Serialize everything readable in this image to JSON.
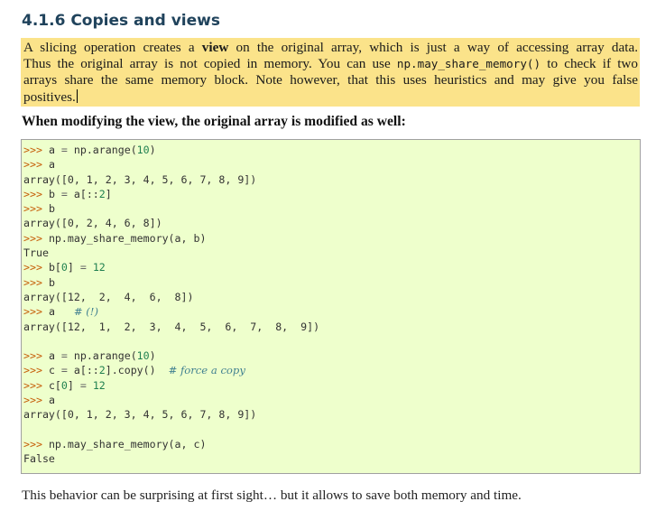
{
  "section_title": "4.1.6 Copies and views",
  "intro": {
    "l1_a": "A slicing operation creates a ",
    "l1_b": "view",
    "l1_c": " on the original array, which is just a way of accessing array data.",
    "l2_a": "Thus the original array is not copied in memory. You can use ",
    "l2_code": "np.may_share_memory()",
    "l2_b": " to check if two",
    "l3": "arrays share the same memory block. Note however, that this uses heuristics and may give you false",
    "l4": "positives."
  },
  "lead_text": "When modifying the view, the original array is modified as well:",
  "code": {
    "prompt": ">>>",
    "l1_a": "a ",
    "l1_op": "=",
    "l1_b": " np.arange(",
    "l1_num": "10",
    "l1_c": ")",
    "l2": "a",
    "l3": "array([0, 1, 2, 3, 4, 5, 6, 7, 8, 9])",
    "l4_a": "b ",
    "l4_op": "=",
    "l4_b": " a[::",
    "l4_num": "2",
    "l4_c": "]",
    "l5": "b",
    "l6": "array([0, 2, 4, 6, 8])",
    "l7": "np.may_share_memory(a, b)",
    "l8": "True",
    "l9_a": "b[",
    "l9_num1": "0",
    "l9_b": "] ",
    "l9_op": "=",
    "l9_sp": " ",
    "l9_num2": "12",
    "l10": "b",
    "l11": "array([12,  2,  4,  6,  8])",
    "l12_a": "a   ",
    "l12_comment": "# (!)",
    "l13": "array([12,  1,  2,  3,  4,  5,  6,  7,  8,  9])",
    "l15_a": "a ",
    "l15_op": "=",
    "l15_b": " np.arange(",
    "l15_num": "10",
    "l15_c": ")",
    "l16_a": "c ",
    "l16_op": "=",
    "l16_b": " a[::",
    "l16_num": "2",
    "l16_c": "].copy()  ",
    "l16_comment": "# force a copy",
    "l17_a": "c[",
    "l17_num1": "0",
    "l17_b": "] ",
    "l17_op": "=",
    "l17_sp": " ",
    "l17_num2": "12",
    "l18": "a",
    "l19": "array([0, 1, 2, 3, 4, 5, 6, 7, 8, 9])",
    "l21": "np.may_share_memory(a, c)",
    "l22": "False"
  },
  "closing_text": "This behavior can be surprising at first sight… but it allows to save both memory and time.",
  "colors": {
    "title": "#20435c",
    "highlight": "#fbe38a",
    "code_bg": "#eeffcc",
    "prompt": "#c65d09",
    "number": "#208050",
    "comment": "#408090"
  }
}
